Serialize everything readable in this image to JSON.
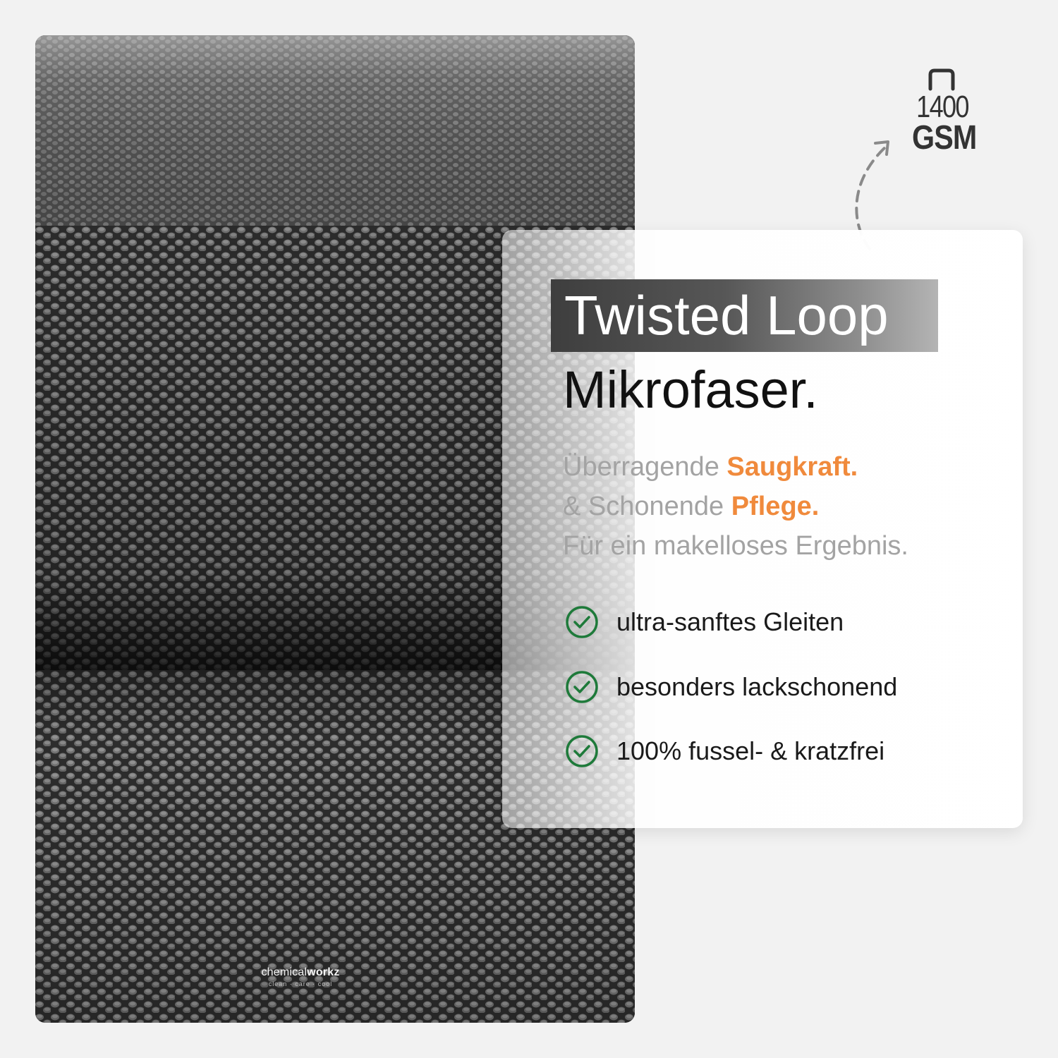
{
  "headline": {
    "title": "Twisted Loop",
    "subtitle": "Mikrofaser."
  },
  "tagline": {
    "line1_prefix": "Überragende ",
    "line1_accent": "Saugkraft.",
    "line2_prefix": "& Schonende ",
    "line2_accent": "Pflege.",
    "line3": "Für ein makelloses Ergebnis."
  },
  "features": [
    {
      "icon": "check-circle-icon",
      "label": "ultra-sanftes Gleiten"
    },
    {
      "icon": "check-circle-icon",
      "label": "besonders lackschonend"
    },
    {
      "icon": "check-circle-icon",
      "label": "100% fussel- & kratzfrei"
    }
  ],
  "gsm_badge": {
    "value": "1400",
    "unit": "GSM",
    "icon": "weight-icon"
  },
  "brand": {
    "name_prefix": "chemical",
    "name_bold": "workz",
    "tagline": "clean · care · cool"
  },
  "colors": {
    "accent_orange": "#f08a3c",
    "check_green": "#1e7a3a",
    "title_box_dark": "#3e3e3e",
    "towel_gray": "#4a4a4a"
  }
}
